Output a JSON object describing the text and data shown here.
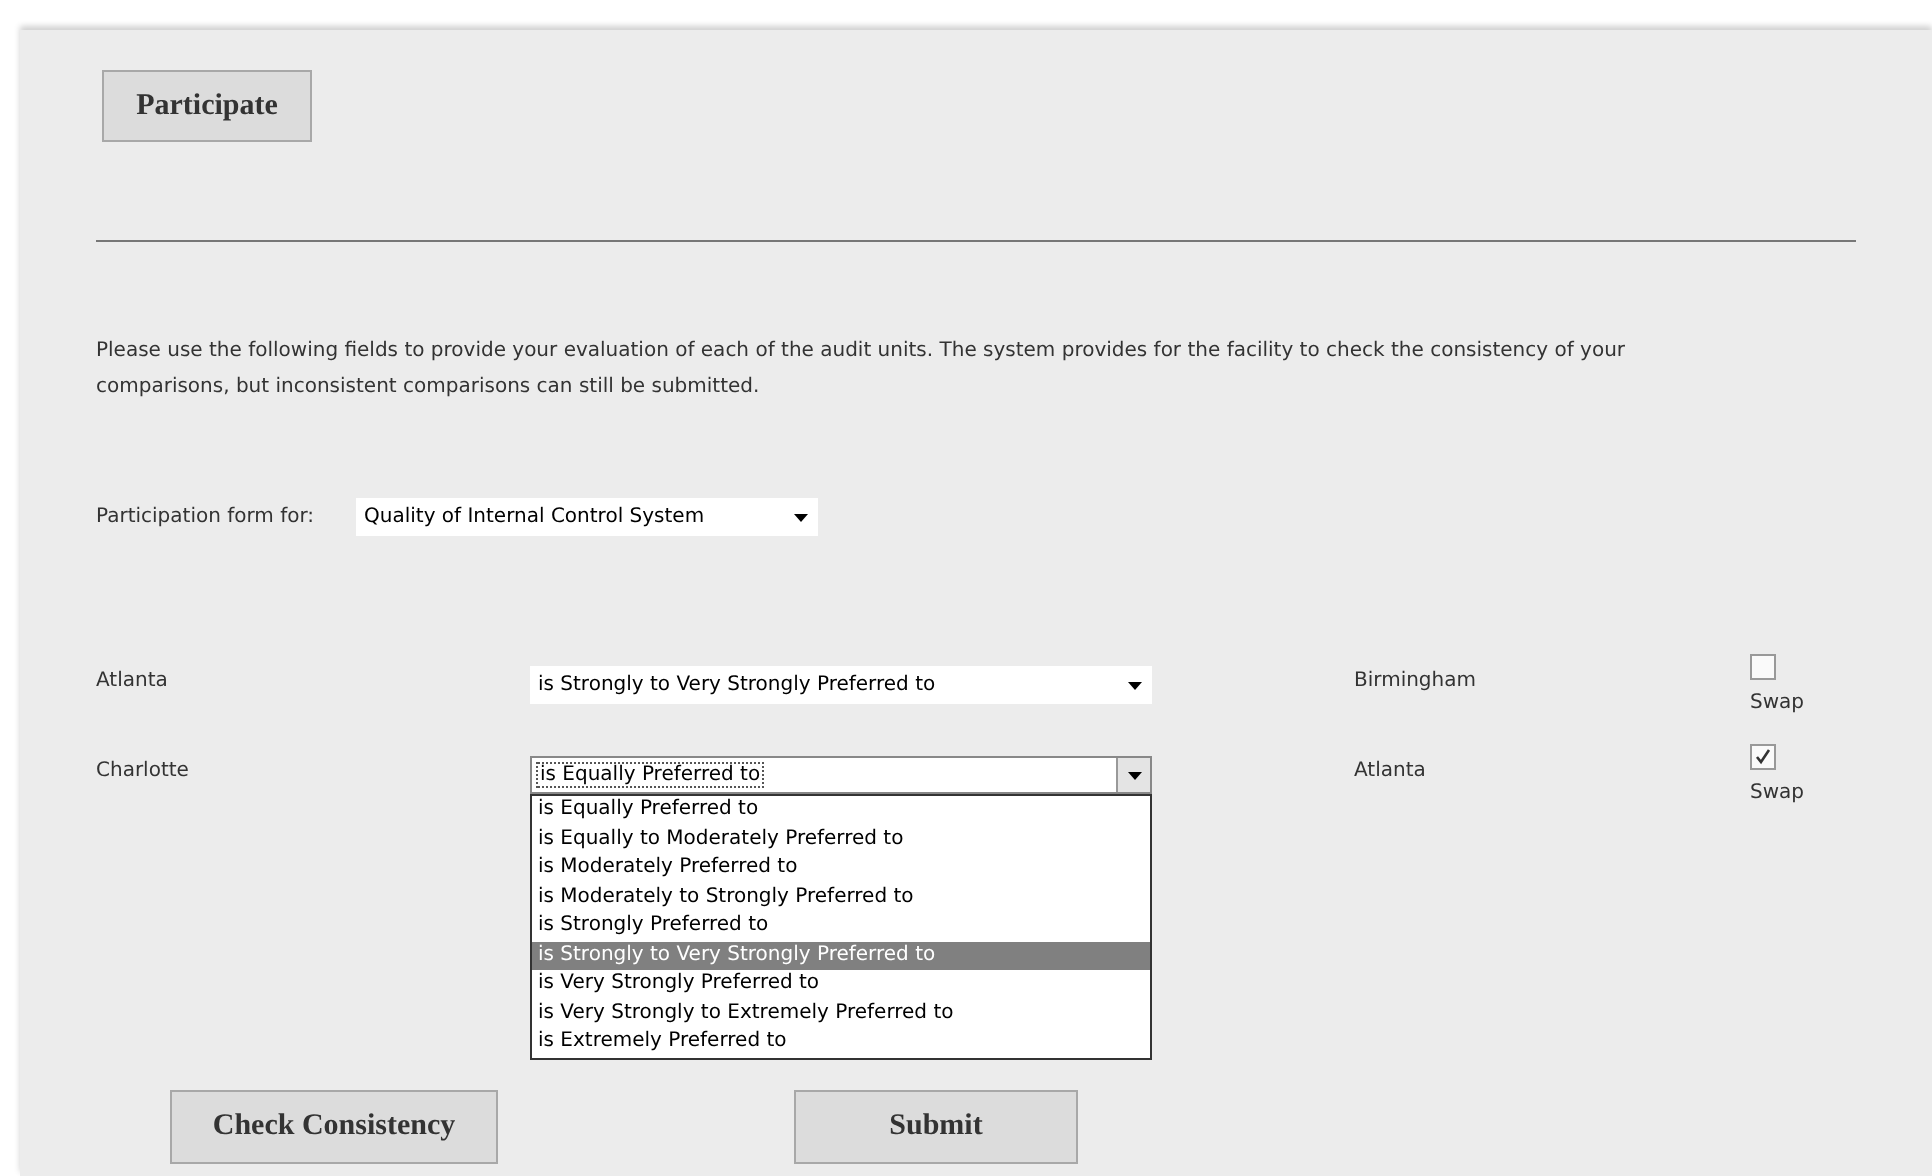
{
  "header_button": "Participate",
  "instructions": "Please use the following fields to provide your evaluation of each of the audit units. The system provides for the facility to check the consistency of your comparisons, but inconsistent comparisons can still be submitted.",
  "form_selector": {
    "label": "Participation form for:",
    "value": "Quality of Internal Control System"
  },
  "comparisons": [
    {
      "left": "Atlanta",
      "value": "is Strongly to Very Strongly Preferred to",
      "expanded": false,
      "right": "Birmingham",
      "swap_label": "Swap",
      "swap_checked": false
    },
    {
      "left": "Charlotte",
      "value": "is Equally Preferred to",
      "expanded": true,
      "right": "Atlanta",
      "swap_label": "Swap",
      "swap_checked": true,
      "options": [
        {
          "label": "is Equally Preferred to",
          "highlighted": false
        },
        {
          "label": "is Equally to Moderately Preferred to",
          "highlighted": false
        },
        {
          "label": "is Moderately Preferred to",
          "highlighted": false
        },
        {
          "label": "is Moderately to Strongly Preferred to",
          "highlighted": false
        },
        {
          "label": "is Strongly Preferred to",
          "highlighted": false
        },
        {
          "label": "is Strongly to Very Strongly Preferred to",
          "highlighted": true
        },
        {
          "label": "is Very Strongly Preferred to",
          "highlighted": false
        },
        {
          "label": "is Very Strongly to Extremely Preferred to",
          "highlighted": false
        },
        {
          "label": "is Extremely Preferred to",
          "highlighted": false
        }
      ]
    }
  ],
  "buttons": [
    "Check Consistency",
    "Submit"
  ]
}
